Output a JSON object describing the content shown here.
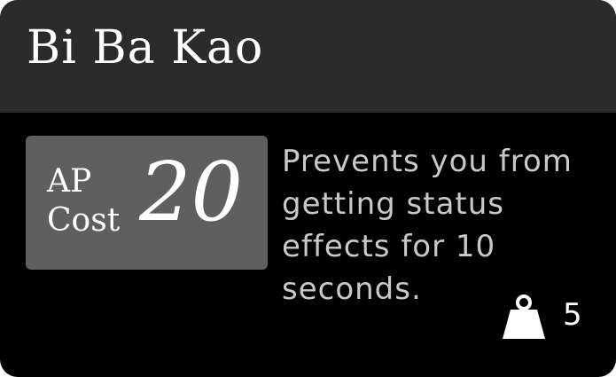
{
  "ability": {
    "name": "Bi Ba Kao",
    "cost": {
      "label_line1": "AP",
      "label_line2": "Cost",
      "value": "20"
    },
    "description": "Prevents you from getting status effects for 10 seconds.",
    "weight": {
      "icon": "weight-icon",
      "value": "5"
    }
  },
  "colors": {
    "card_background": "#000000",
    "header_background": "#2b2b2b",
    "cost_box_background": "#5f5f5f",
    "title_text": "#ffffff",
    "description_text": "#c9c9c9"
  }
}
